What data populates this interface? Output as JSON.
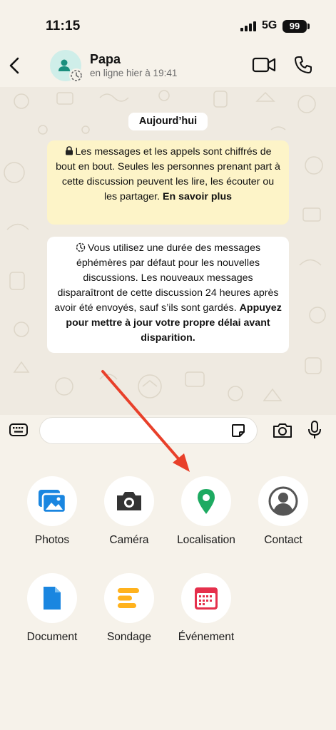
{
  "status_bar": {
    "time": "11:15",
    "network": "5G",
    "battery": "99"
  },
  "header": {
    "contact_name": "Papa",
    "contact_status": "en ligne hier à 19:41"
  },
  "chat": {
    "date_label": "Aujourd’hui",
    "encryption_notice": {
      "text": "Les messages et les appels sont chiffrés de bout en bout. Seules les personnes prenant part à cette discussion peuvent les lire, les écouter ou les partager.",
      "link": "En savoir plus"
    },
    "ephemeral_notice": {
      "text": "Vous utilisez une durée des messages éphémères par défaut pour les nouvelles discussions. Les nouveaux messages disparaîtront de cette discussion 24 heures après avoir été envoyés, sauf s’ils sont gardés.",
      "bold": "Appuyez pour mettre à jour votre propre délai avant disparition."
    }
  },
  "compose": {
    "input_value": ""
  },
  "attach_menu": {
    "photos": "Photos",
    "camera": "Caméra",
    "location": "Localisation",
    "contact": "Contact",
    "document": "Document",
    "poll": "Sondage",
    "event": "Événement"
  },
  "colors": {
    "background": "#f6f2ea",
    "chat_background": "#efeae1",
    "encryption_notice": "#fdf4c8",
    "photos_blue": "#1a86e0",
    "location_green": "#1daa61",
    "poll_orange": "#ffb21d",
    "event_red": "#e5304c",
    "arrow_red": "#e8402a"
  },
  "icons": [
    "keyboard-icon",
    "sticker-icon",
    "camera-icon",
    "mic-icon",
    "video-icon",
    "phone-icon",
    "back-chevron-icon",
    "lock-icon",
    "timer-icon"
  ]
}
